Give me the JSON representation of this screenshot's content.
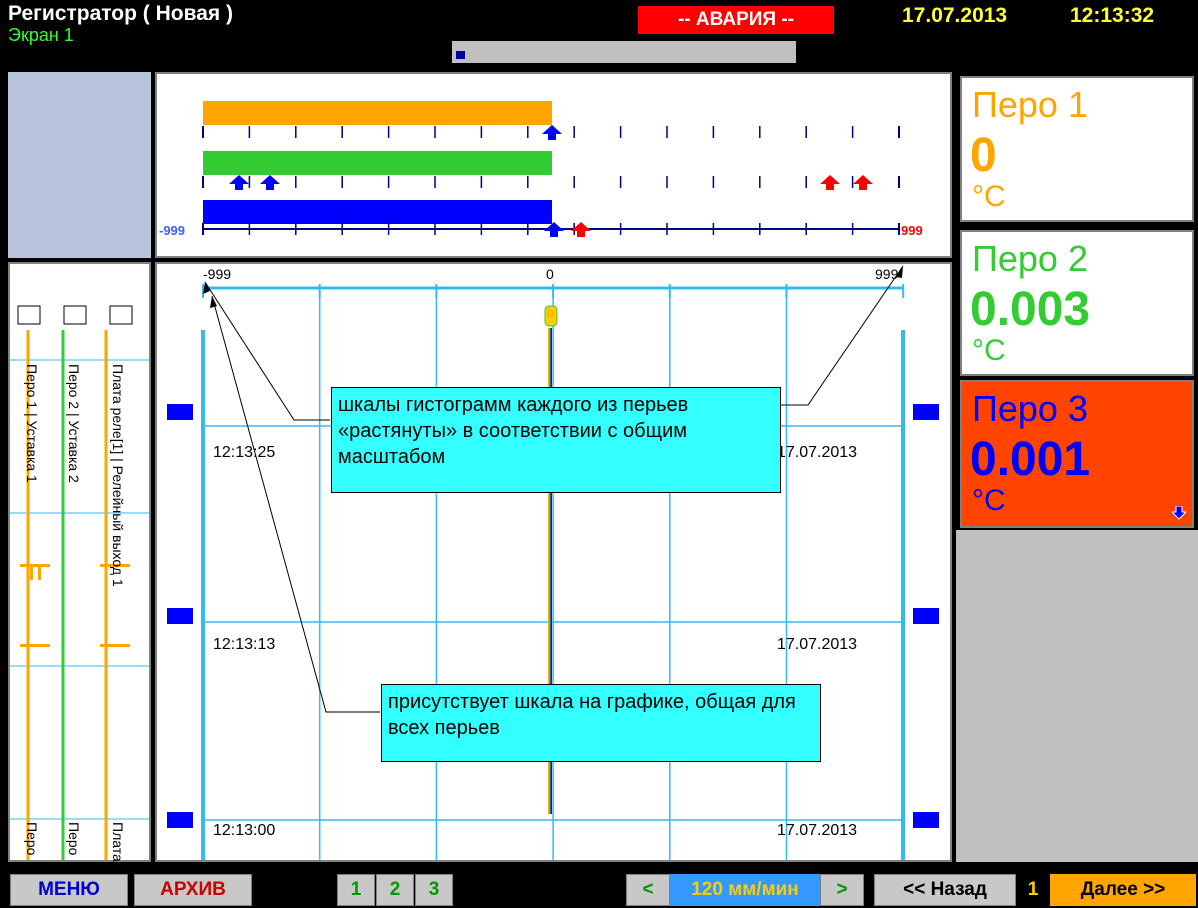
{
  "header": {
    "title": "Регистратор ( Новая )",
    "screen": "Экран 1",
    "alarm": "-- АВАРИЯ --",
    "date": "17.07.2013",
    "time": "12:13:32"
  },
  "histogram": {
    "min_label": "-999",
    "max_label": "999"
  },
  "chart": {
    "scale_labels": [
      "-999",
      "0",
      "999"
    ],
    "time_rows": [
      {
        "time": "12:13:25",
        "date": "17.07.2013"
      },
      {
        "time": "12:13:13",
        "date": "17.07.2013"
      },
      {
        "time": "12:13:00",
        "date": "17.07.2013"
      }
    ],
    "marker_value": "0"
  },
  "legend": {
    "items": [
      {
        "label": "Перо 1 | Уставка 1",
        "short": "Перо",
        "color": "#ffa500"
      },
      {
        "label": "Перо 2 | Уставка 2",
        "short": "Перо",
        "color": "#33cc33"
      },
      {
        "label": "Плата реле[1] | Релейный выход 1",
        "short": "Плата",
        "color": "#ffa500"
      }
    ]
  },
  "pens": [
    {
      "name": "Перо 1",
      "value": "0",
      "unit": "°C",
      "color": "#ffa500",
      "bg": "#ffffff"
    },
    {
      "name": "Перо 2",
      "value": "0.003",
      "unit": "°C",
      "color": "#33cc33",
      "bg": "#ffffff"
    },
    {
      "name": "Перо 3",
      "value": "0.001",
      "unit": "°C",
      "color": "#0000ff",
      "bg": "#ff4400"
    }
  ],
  "callouts": {
    "top": "шкалы гистограмм каждого из перьев «растянуты» в соответствии с общим масштабом",
    "bottom": "присутствует шкала на графике, общая для всех перьев"
  },
  "toolbar": {
    "menu": "МЕНЮ",
    "archive": "АРХИВ",
    "screens": [
      "1",
      "2",
      "3"
    ],
    "prev_speed": "<",
    "speed": "120 мм/мин",
    "next_speed": ">",
    "back": "<< Назад",
    "page": "1",
    "forward": "Далее >>"
  },
  "colors": {
    "pen1": "#ffa500",
    "pen2": "#33cc33",
    "pen3": "#0000ff",
    "grid": "#33bbee",
    "alarm": "#ff0000"
  }
}
